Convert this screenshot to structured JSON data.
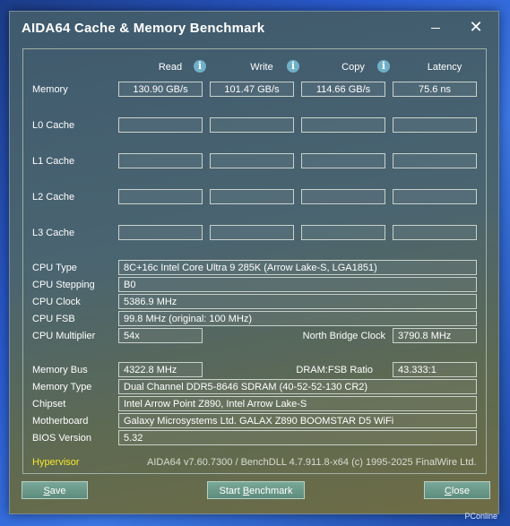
{
  "window": {
    "title": "AIDA64 Cache & Memory Benchmark"
  },
  "headers": {
    "read": "Read",
    "write": "Write",
    "copy": "Copy",
    "latency": "Latency"
  },
  "rows": {
    "memory": {
      "label": "Memory",
      "read": "130.90 GB/s",
      "write": "101.47 GB/s",
      "copy": "114.66 GB/s",
      "latency": "75.6 ns"
    },
    "l0": {
      "label": "L0 Cache",
      "read": "",
      "write": "",
      "copy": "",
      "latency": ""
    },
    "l1": {
      "label": "L1 Cache",
      "read": "",
      "write": "",
      "copy": "",
      "latency": ""
    },
    "l2": {
      "label": "L2 Cache",
      "read": "",
      "write": "",
      "copy": "",
      "latency": ""
    },
    "l3": {
      "label": "L3 Cache",
      "read": "",
      "write": "",
      "copy": "",
      "latency": ""
    }
  },
  "cpu": {
    "type_label": "CPU Type",
    "type": "8C+16c Intel Core Ultra 9 285K  (Arrow Lake-S, LGA1851)",
    "stepping_label": "CPU Stepping",
    "stepping": "B0",
    "clock_label": "CPU Clock",
    "clock": "5386.9 MHz",
    "fsb_label": "CPU FSB",
    "fsb": "99.8 MHz  (original: 100 MHz)",
    "multiplier_label": "CPU Multiplier",
    "multiplier": "54x",
    "nb_clock_label": "North Bridge Clock",
    "nb_clock": "3790.8 MHz"
  },
  "memory_info": {
    "bus_label": "Memory Bus",
    "bus": "4322.8 MHz",
    "ratio_label": "DRAM:FSB Ratio",
    "ratio": "43.333:1",
    "type_label": "Memory Type",
    "type": "Dual Channel DDR5-8646 SDRAM  (40-52-52-130 CR2)",
    "chipset_label": "Chipset",
    "chipset": "Intel Arrow Point Z890, Intel Arrow Lake-S",
    "motherboard_label": "Motherboard",
    "motherboard": "Galaxy Microsystems Ltd. GALAX Z890 BOOMSTAR D5 WiFi",
    "bios_label": "BIOS Version",
    "bios": "5.32"
  },
  "footer": {
    "hypervisor": "Hypervisor",
    "version": "AIDA64 v7.60.7300 / BenchDLL 4.7.911.8-x64  (c) 1995-2025 FinalWire Ltd."
  },
  "buttons": {
    "save_u": "S",
    "save_rest": "ave",
    "start_pre": "Start ",
    "start_u": "B",
    "start_rest": "enchmark",
    "close_u": "C",
    "close_rest": "lose"
  },
  "watermark": "PConline",
  "icons": {
    "info": "info-icon",
    "minimize": "minimize-icon",
    "close": "close-icon"
  }
}
